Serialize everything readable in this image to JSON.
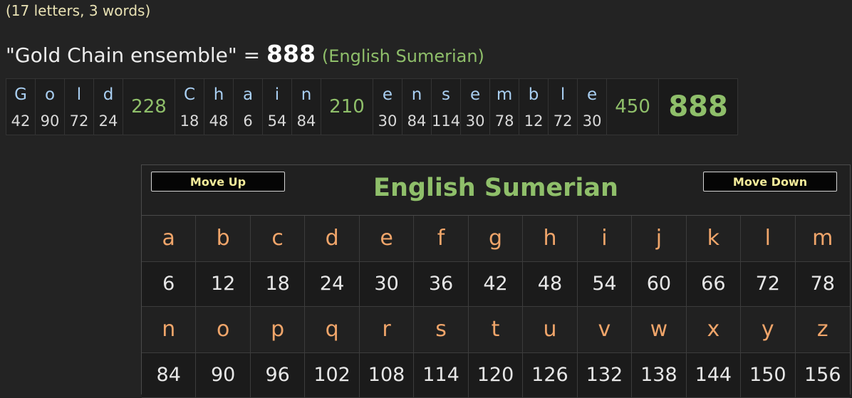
{
  "summary": "(17 letters, 3 words)",
  "phrase": {
    "text": "\"Gold Chain ensemble\"",
    "equals": "=",
    "total": "888",
    "cipher_name": "(English Sumerian)"
  },
  "breakdown": {
    "words": [
      {
        "letters": [
          {
            "ch": "G",
            "val": "42"
          },
          {
            "ch": "o",
            "val": "90"
          },
          {
            "ch": "l",
            "val": "72"
          },
          {
            "ch": "d",
            "val": "24"
          }
        ],
        "sum": "228"
      },
      {
        "letters": [
          {
            "ch": "C",
            "val": "18"
          },
          {
            "ch": "h",
            "val": "48"
          },
          {
            "ch": "a",
            "val": "6"
          },
          {
            "ch": "i",
            "val": "54"
          },
          {
            "ch": "n",
            "val": "84"
          }
        ],
        "sum": "210"
      },
      {
        "letters": [
          {
            "ch": "e",
            "val": "30"
          },
          {
            "ch": "n",
            "val": "84"
          },
          {
            "ch": "s",
            "val": "114"
          },
          {
            "ch": "e",
            "val": "30"
          },
          {
            "ch": "m",
            "val": "78"
          },
          {
            "ch": "b",
            "val": "12"
          },
          {
            "ch": "l",
            "val": "72"
          },
          {
            "ch": "e",
            "val": "30"
          }
        ],
        "sum": "450"
      }
    ],
    "total": "888"
  },
  "panel": {
    "move_up": "Move Up",
    "move_down": "Move Down",
    "title": "English Sumerian",
    "rows": [
      {
        "letters": [
          "a",
          "b",
          "c",
          "d",
          "e",
          "f",
          "g",
          "h",
          "i",
          "j",
          "k",
          "l",
          "m"
        ],
        "values": [
          "6",
          "12",
          "18",
          "24",
          "30",
          "36",
          "42",
          "48",
          "54",
          "60",
          "66",
          "72",
          "78"
        ]
      },
      {
        "letters": [
          "n",
          "o",
          "p",
          "q",
          "r",
          "s",
          "t",
          "u",
          "v",
          "w",
          "x",
          "y",
          "z"
        ],
        "values": [
          "84",
          "90",
          "96",
          "102",
          "108",
          "114",
          "120",
          "126",
          "132",
          "138",
          "144",
          "150",
          "156"
        ]
      }
    ]
  },
  "colors": {
    "accent_green": "#8fbf6a",
    "letter_orange": "#f0a56a",
    "letter_blue": "#a9cff2",
    "button_text": "#f3eb9a"
  }
}
